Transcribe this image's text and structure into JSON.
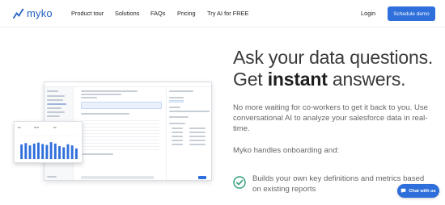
{
  "header": {
    "logo_text": "myko",
    "nav": [
      {
        "label": "Product tour"
      },
      {
        "label": "Solutions"
      },
      {
        "label": "FAQs"
      },
      {
        "label": "Pricing"
      },
      {
        "label": "Try AI for FREE"
      }
    ],
    "login_label": "Login",
    "cta_label": "Schedule demo"
  },
  "hero": {
    "headline_line1": "Ask your data questions.",
    "headline_get": "Get",
    "headline_bold": "instant",
    "headline_end": "answers.",
    "paragraph": "No more waiting for co-workers to get it back to you. Use conversational AI to analyze your salesforce data in real-time.",
    "onboarding": "Myko handles onboarding and:",
    "bullet_1": "Builds your own key definitions and metrics based on existing reports"
  },
  "chat": {
    "label": "Chat with us"
  },
  "colors": {
    "brand": "#2f6fdb",
    "check": "#2e9c7a",
    "text": "#3a3a3a"
  },
  "chart_data": {
    "type": "bar",
    "values": [
      62,
      68,
      58,
      66,
      70,
      64,
      60,
      72,
      66,
      55,
      50,
      63,
      58,
      45
    ],
    "ylim": [
      0,
      100
    ]
  }
}
